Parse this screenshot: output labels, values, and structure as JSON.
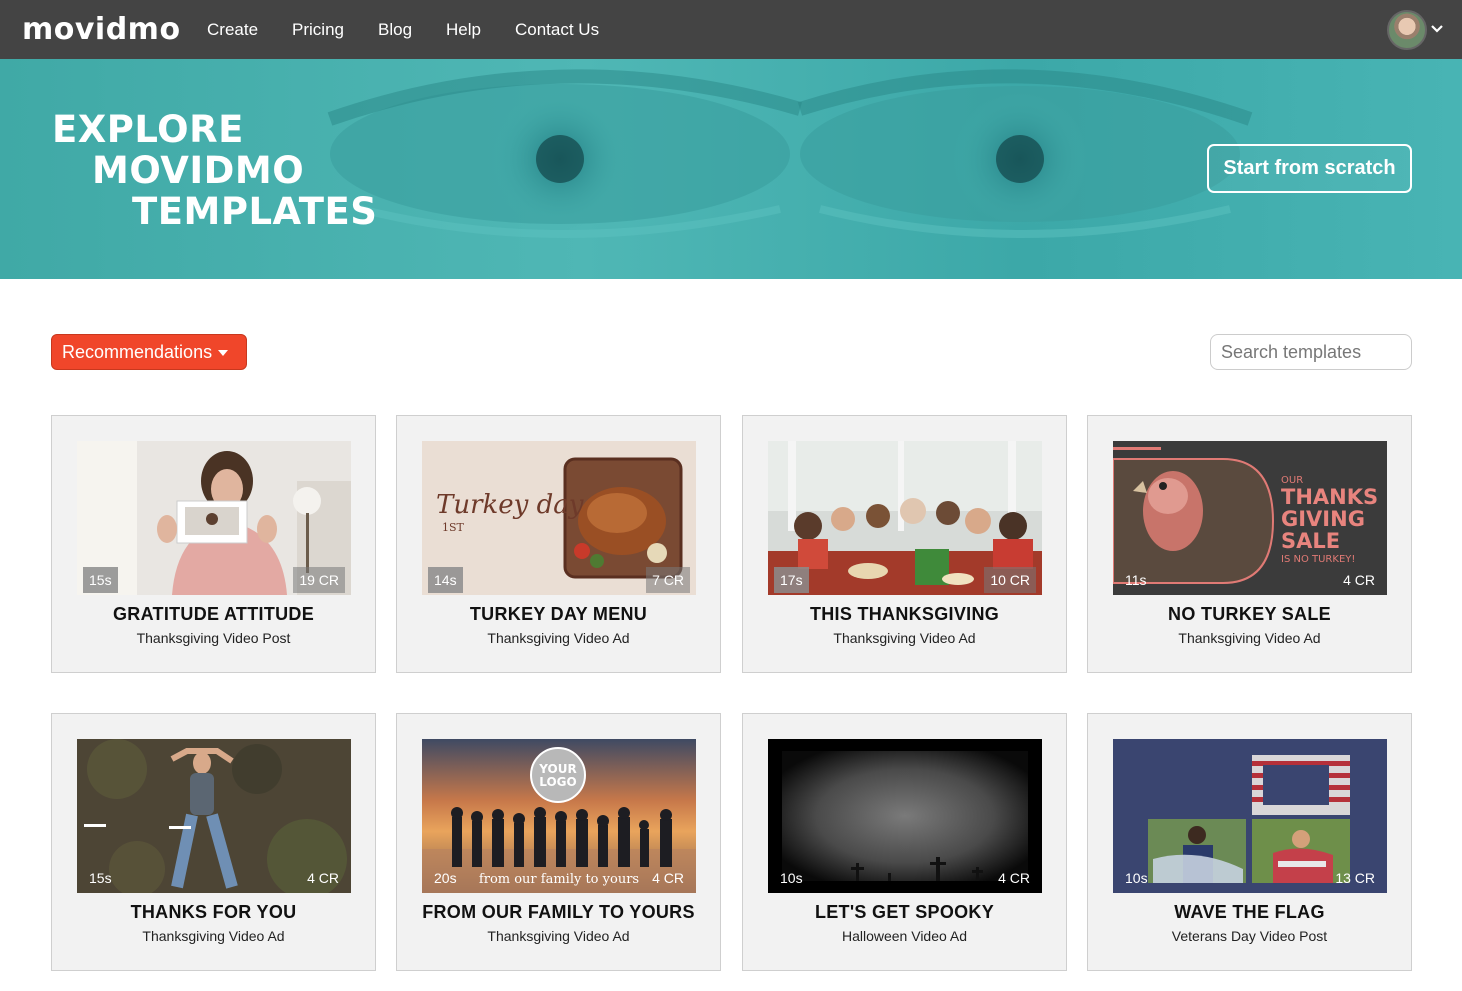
{
  "nav": {
    "logo": "movidmo",
    "links": [
      "Create",
      "Pricing",
      "Blog",
      "Help",
      "Contact Us"
    ],
    "avatar_icon": "user-avatar",
    "menu_icon": "chevron-down-icon"
  },
  "hero": {
    "title_line1": "EXPLORE",
    "title_line2": "MOVIDMO",
    "title_line3": "TEMPLATES",
    "cta": "Start from scratch"
  },
  "controls": {
    "sort_label": "Recommendations",
    "search_placeholder": "Search templates"
  },
  "colors": {
    "nav_bg": "#444444",
    "hero_teal": "#45b0ae",
    "accent_orange": "#f0462a",
    "card_bg": "#f2f2f2"
  },
  "templates": [
    {
      "title": "GRATITUDE ATTITUDE",
      "subtitle": "Thanksgiving Video Post",
      "duration": "15s",
      "credits": "19 CR"
    },
    {
      "title": "TURKEY DAY MENU",
      "subtitle": "Thanksgiving Video Ad",
      "duration": "14s",
      "credits": "7 CR",
      "thumb_text": "Turkey day",
      "thumb_text2": "1ST"
    },
    {
      "title": "THIS THANKSGIVING",
      "subtitle": "Thanksgiving Video Ad",
      "duration": "17s",
      "credits": "10 CR"
    },
    {
      "title": "NO TURKEY SALE",
      "subtitle": "Thanksgiving Video Ad",
      "duration": "11s",
      "credits": "4 CR",
      "thumb_text": [
        "OUR",
        "THANKS",
        "GIVING",
        "SALE",
        "IS NO TURKEY!"
      ]
    },
    {
      "title": "THANKS FOR YOU",
      "subtitle": "Thanksgiving Video Ad",
      "duration": "15s",
      "credits": "4 CR"
    },
    {
      "title": "FROM OUR FAMILY TO YOURS",
      "subtitle": "Thanksgiving Video Ad",
      "duration": "20s",
      "credits": "4 CR",
      "thumb_text": [
        "YOUR",
        "LOGO"
      ],
      "thumb_caption": "from our family to yours"
    },
    {
      "title": "LET'S GET SPOOKY",
      "subtitle": "Halloween Video Ad",
      "duration": "10s",
      "credits": "4 CR"
    },
    {
      "title": "WAVE THE FLAG",
      "subtitle": "Veterans Day Video Post",
      "duration": "10s",
      "credits": "13 CR"
    }
  ]
}
